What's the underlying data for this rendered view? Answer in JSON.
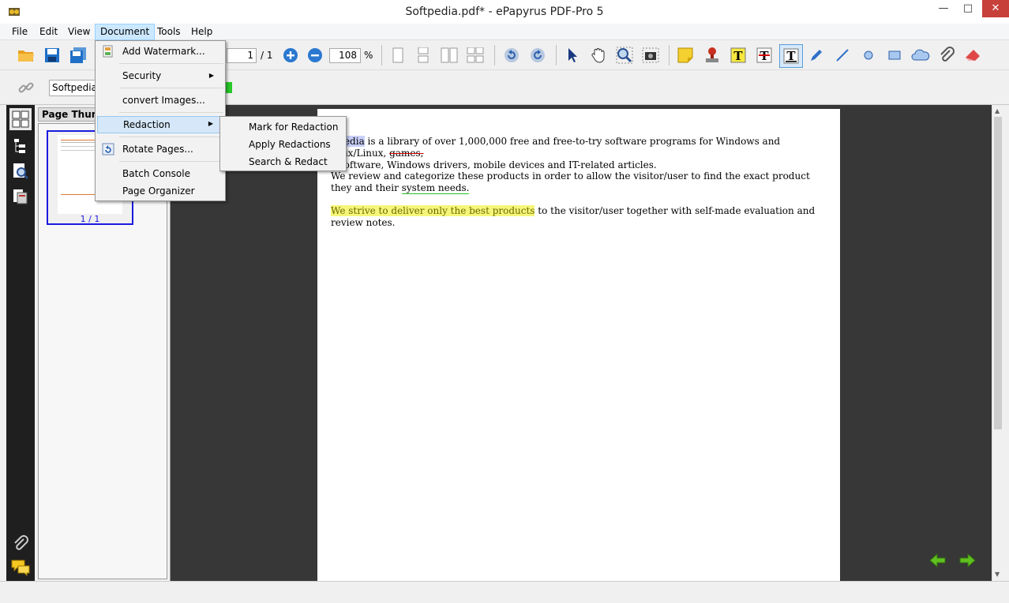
{
  "window": {
    "title": "Softpedia.pdf* - ePapyrus PDF-Pro 5"
  },
  "menubar": {
    "items": [
      "File",
      "Edit",
      "View",
      "Document",
      "Tools",
      "Help"
    ],
    "active": "Document"
  },
  "toolbar": {
    "page_current": "1",
    "page_total": "/ 1",
    "zoom_value": "108",
    "zoom_unit": "%",
    "icons": [
      "open-folder-icon",
      "save-icon",
      "save-all-icon",
      "zoom-in-icon",
      "zoom-out-icon",
      "single-page-icon",
      "continuous-page-icon",
      "facing-page-icon",
      "continuous-facing-icon",
      "rotate-left-icon",
      "rotate-right-icon",
      "select-arrow-icon",
      "hand-tool-icon",
      "marquee-zoom-icon",
      "snapshot-icon",
      "sticky-note-icon",
      "stamp-icon",
      "highlight-text-icon",
      "strikeout-text-icon",
      "underline-text-icon",
      "pen-icon",
      "line-icon",
      "ellipse-icon",
      "rectangle-icon",
      "cloud-icon",
      "attachment-icon",
      "eraser-icon"
    ]
  },
  "search": {
    "value": "Softpedia"
  },
  "thumbnails": {
    "header": "Page Thumbnails",
    "page_label": "1 / 1"
  },
  "document_menu": {
    "items": [
      {
        "label": "Add Watermark...",
        "icon": "watermark-icon"
      },
      {
        "label": "Security",
        "submenu": true
      },
      {
        "label": "convert Images..."
      },
      {
        "label": "Redaction",
        "submenu": true,
        "highlighted": true
      },
      {
        "label": "Rotate Pages...",
        "icon": "rotate-pages-icon"
      },
      {
        "label": "Batch Console"
      },
      {
        "label": "Page Organizer"
      }
    ]
  },
  "redaction_submenu": {
    "items": [
      "Mark for Redaction",
      "Apply Redactions",
      "Search & Redact"
    ]
  },
  "pdf": {
    "p1_highlight": "ftpedia",
    "p1_text_a": " is a library of over 1,000,000 free and free-to-try software programs for Windows and Unix/Linux, ",
    "p1_strike": "games,",
    "p1_text_b": "c software, Windows drivers, mobile devices and IT-related articles.",
    "p2_text": "We review and categorize these products in order to allow the visitor/user to find the exact product they and their ",
    "p2_underline": "system needs.",
    "p3_highlight": "We strive to deliver only the best products",
    "p3_text": " to the visitor/user together with self-made evaluation and review notes."
  },
  "colors": {
    "accent": "#1a1ae0",
    "highlight_yellow": "#f5f57a",
    "highlight_blue": "#c8cff8",
    "strike_red": "#d00000",
    "underline_green": "#20c020"
  }
}
